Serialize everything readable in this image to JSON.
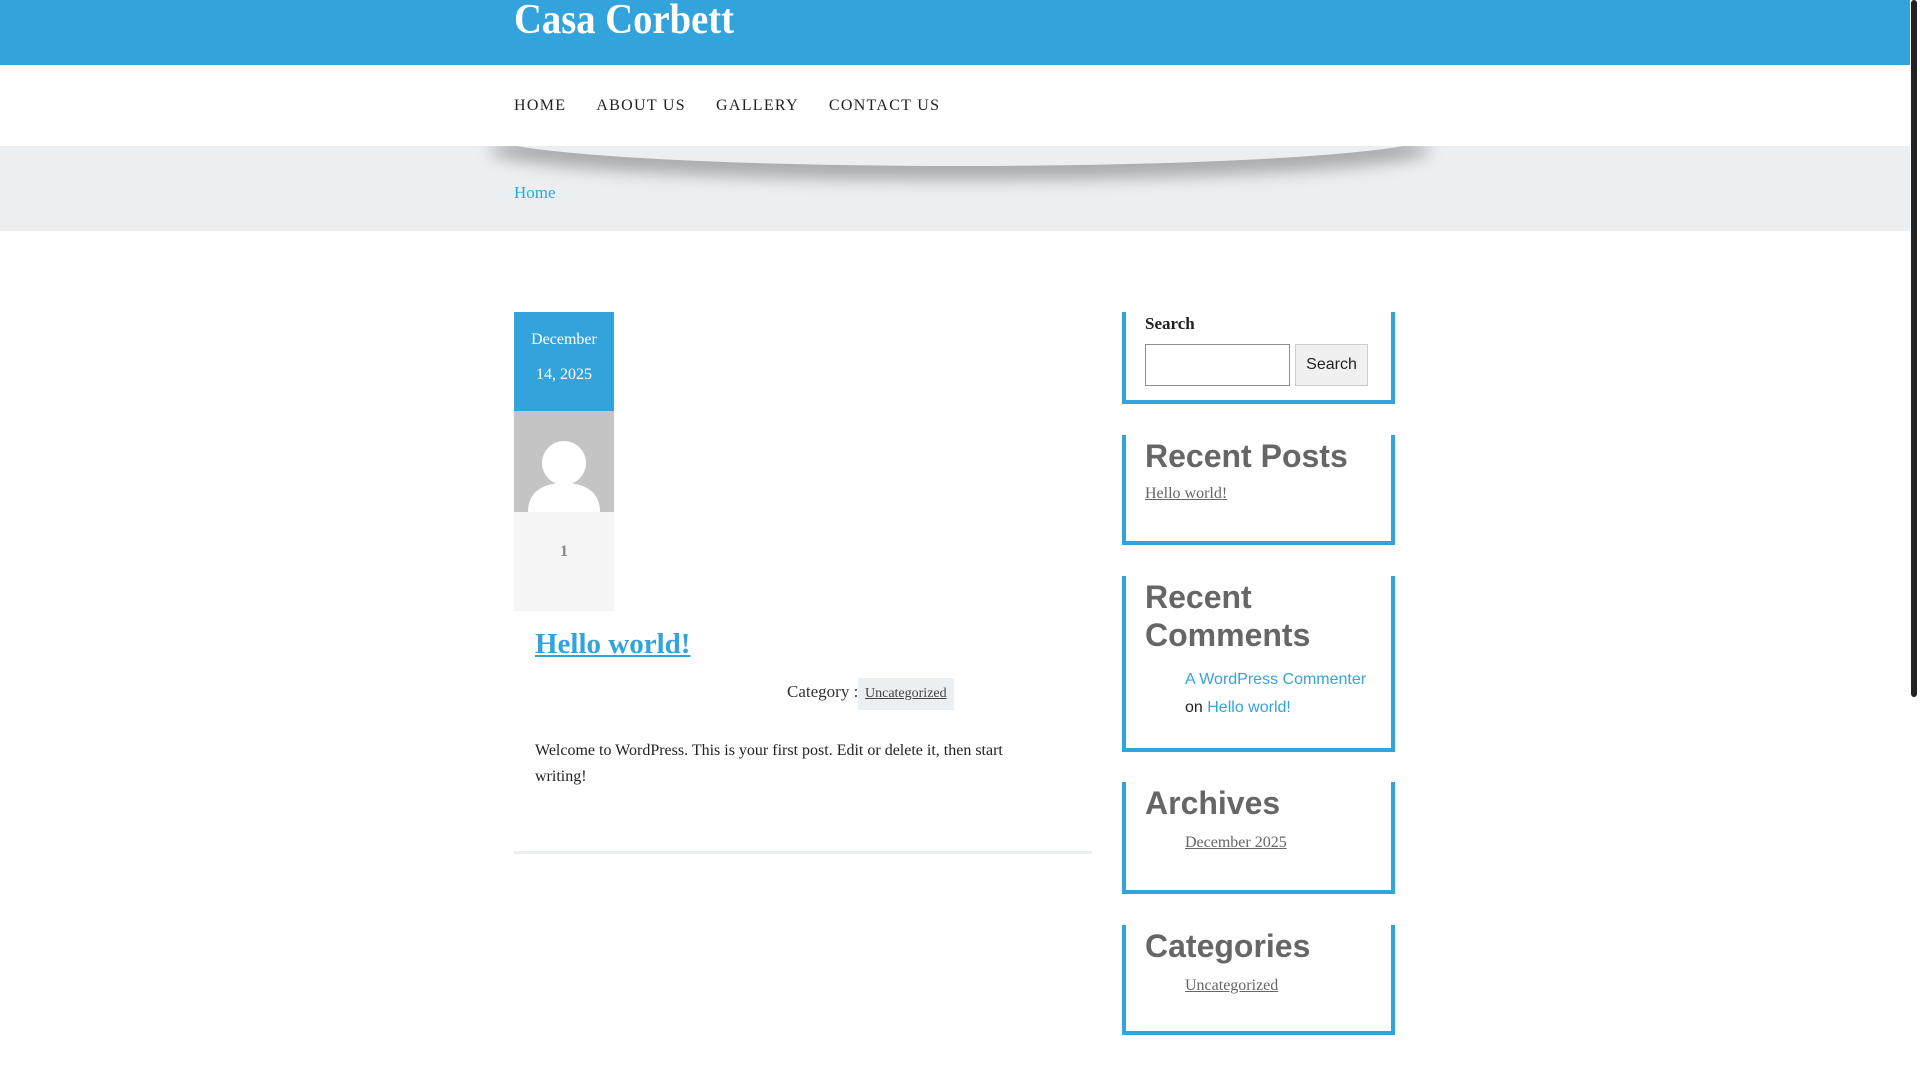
{
  "site": {
    "title": "Casa Corbett"
  },
  "nav": [
    "HOME",
    "ABOUT US",
    "GALLERY",
    "CONTACT US"
  ],
  "breadcrumb": "Home",
  "post": {
    "date_line1": "December",
    "date_line2": "14, 2025",
    "comment_count": "1",
    "title": "Hello world!",
    "category_label": "Category :",
    "category": "Uncategorized",
    "excerpt": "Welcome to WordPress. This is your first post. Edit or delete it, then start writing!"
  },
  "sidebar": {
    "search": {
      "label": "Search",
      "button": "Search",
      "placeholder": ""
    },
    "recent_posts": {
      "title": "Recent Posts",
      "items": [
        "Hello world!"
      ]
    },
    "recent_comments": {
      "title": "Recent Comments",
      "author": "A WordPress Commenter",
      "on": "on",
      "post": "Hello world!"
    },
    "archives": {
      "title": "Archives",
      "items": [
        "December 2025"
      ]
    },
    "categories": {
      "title": "Categories",
      "items": [
        "Uncategorized"
      ]
    }
  },
  "colors": {
    "accent": "#33a3dc"
  }
}
